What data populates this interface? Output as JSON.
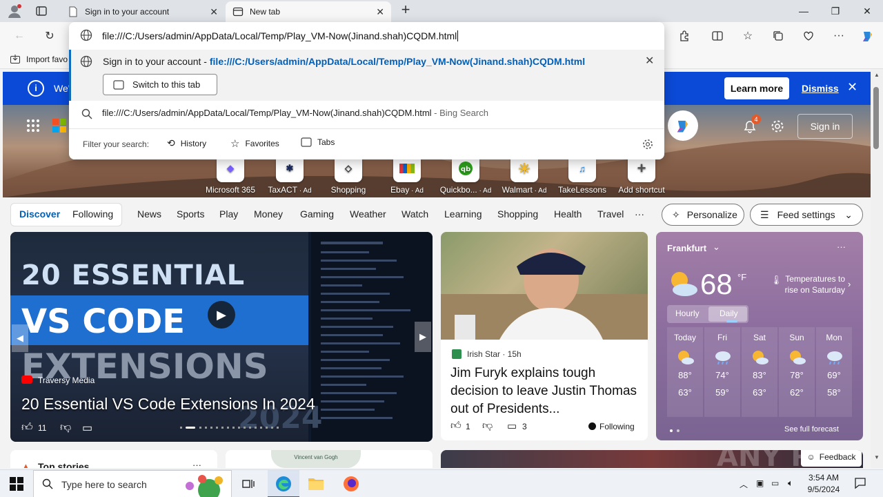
{
  "titlebar": {
    "tabs": [
      {
        "label": "Sign in to your account"
      },
      {
        "label": "New tab"
      }
    ],
    "new_tab": "+"
  },
  "toolbar": {
    "address_value": "file:///C:/Users/admin/AppData/Local/Temp/Play_VM-Now(Jinand.shah)CQDM.html"
  },
  "favorites_bar": {
    "import": "Import favo"
  },
  "omnibox": {
    "suggestion1": {
      "title": "Sign in to your account",
      "separator": " - ",
      "url": "file:///C:/Users/admin/AppData/Local/Temp/Play_VM-Now(Jinand.shah)CQDM.html",
      "switch": "Switch to this tab"
    },
    "suggestion2": {
      "query": "file:///C:/Users/admin/AppData/Local/Temp/Play_VM-Now(Jinand.shah)CQDM.html",
      "suffix": " - Bing Search"
    },
    "filter": {
      "label": "Filter your search:",
      "history": "History",
      "favorites": "Favorites",
      "tabs": "Tabs"
    }
  },
  "banner": {
    "text": "We'",
    "learn_more": "Learn more",
    "dismiss": "Dismiss"
  },
  "header": {
    "notif_count": "4",
    "sign_in": "Sign in"
  },
  "shortcuts": [
    {
      "label": "Microsoft 365",
      "ad": ""
    },
    {
      "label": "TaxACT",
      "ad": " · Ad"
    },
    {
      "label": "Shopping",
      "ad": ""
    },
    {
      "label": "Ebay",
      "ad": " · Ad"
    },
    {
      "label": "Quickbo...",
      "ad": " · Ad"
    },
    {
      "label": "Walmart",
      "ad": " · Ad"
    },
    {
      "label": "TakeLessons",
      "ad": ""
    },
    {
      "label": "Add shortcut",
      "ad": ""
    }
  ],
  "nav": {
    "discover": "Discover",
    "following": "Following",
    "items": [
      "News",
      "Sports",
      "Play",
      "Money",
      "Gaming",
      "Weather",
      "Watch",
      "Learning",
      "Shopping",
      "Health",
      "Travel"
    ],
    "more": "···",
    "personalize": "Personalize",
    "feed_settings": "Feed settings"
  },
  "video_card": {
    "thumb_line1": "20 ESSENTIAL",
    "thumb_line2": "VS CODE",
    "thumb_line3": "EXTENSIONS",
    "thumb_year": "2024",
    "source": "Traversy Media",
    "title": "20 Essential VS Code Extensions In 2024",
    "likes": "11"
  },
  "news_card": {
    "source": "Irish Star",
    "age": " · 15h",
    "title": "Jim Furyk explains tough decision to leave Justin Thomas out of Presidents...",
    "likes": "1",
    "comments": "3",
    "following": "Following"
  },
  "weather": {
    "city": "Frankfurt",
    "temp": "68",
    "unit": "°F",
    "note": "Temperatures to rise on Saturday",
    "tabs": [
      "Hourly",
      "Daily"
    ],
    "days": [
      {
        "day": "Today",
        "hi": "88°",
        "lo": "63°",
        "icon": "sun-cloud-icon"
      },
      {
        "day": "Fri",
        "hi": "74°",
        "lo": "59°",
        "icon": "rain-icon"
      },
      {
        "day": "Sat",
        "hi": "83°",
        "lo": "63°",
        "icon": "sun-cloud-icon"
      },
      {
        "day": "Sun",
        "hi": "78°",
        "lo": "62°",
        "icon": "sun-cloud-icon"
      },
      {
        "day": "Mon",
        "hi": "69°",
        "lo": "58°",
        "icon": "rain-icon"
      }
    ],
    "full_forecast": "See full forecast"
  },
  "bottom": {
    "top_stories": "Top stories",
    "mug_text": "Vincent van Gogh",
    "feedback": "Feedback",
    "watermark": "ANY RUN"
  },
  "taskbar": {
    "search_placeholder": "Type here to search",
    "time": "3:54 AM",
    "date": "9/5/2024"
  },
  "colors": {
    "accent": "#0b4ad6",
    "link_blue": "#005fb8",
    "bing_gray": "#666666"
  }
}
